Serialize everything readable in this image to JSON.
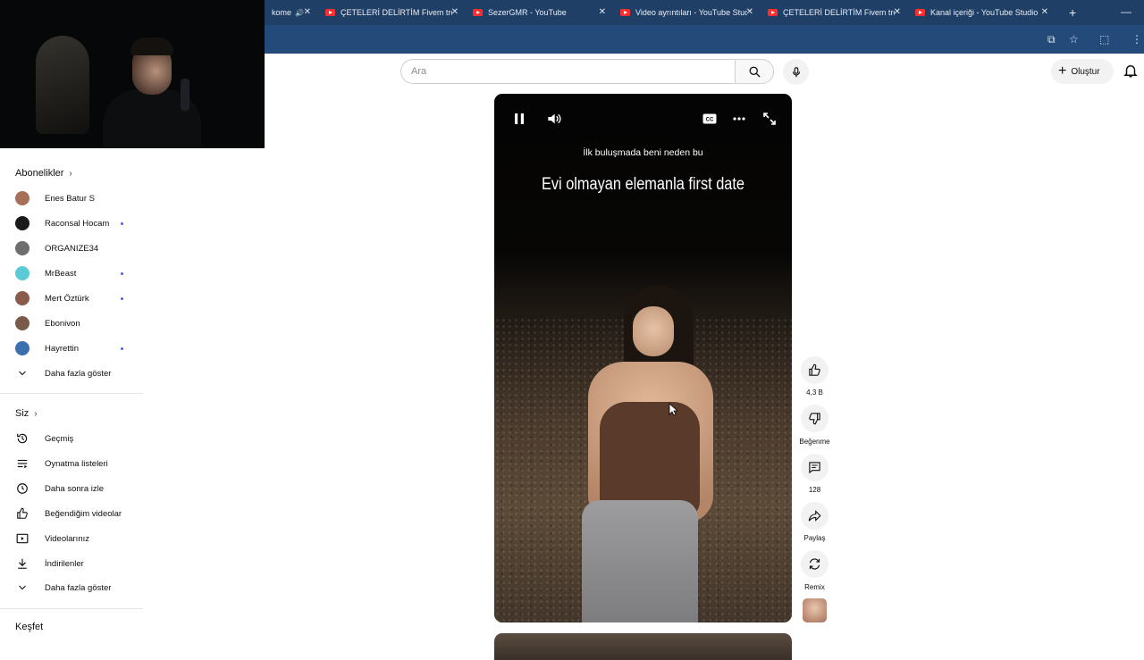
{
  "browser": {
    "tabs": [
      {
        "title": "kome",
        "audio": true
      },
      {
        "title": "ÇETELERİ DELİRTİM Fivem troll..."
      },
      {
        "title": "SezerGMR - YouTube"
      },
      {
        "title": "Video ayrıntıları - YouTube Stud..."
      },
      {
        "title": "ÇETELERİ DELİRTİM Fivem troll..."
      },
      {
        "title": "Kanal içeriği - YouTube Studio"
      }
    ],
    "newtab": "+",
    "minimize": "—"
  },
  "search": {
    "placeholder": "Ara"
  },
  "header": {
    "create_label": "Oluştur"
  },
  "sidebar": {
    "subscriptions_title": "Abonelikler",
    "subscriptions": [
      {
        "label": "Enes Batur S",
        "avatar_color": "#a86f58",
        "new": false
      },
      {
        "label": "Raconsal Hocam",
        "avatar_color": "#1a1a1a",
        "new": true
      },
      {
        "label": "ORGANIZE34",
        "avatar_color": "#6e6e6e",
        "new": false
      },
      {
        "label": "MrBeast",
        "avatar_color": "#5cc9d6",
        "new": true
      },
      {
        "label": "Mert Öztürk",
        "avatar_color": "#8a5a4a",
        "new": true
      },
      {
        "label": "Ebonivon",
        "avatar_color": "#7a5a48",
        "new": false
      },
      {
        "label": "Hayrettin",
        "avatar_color": "#3b6fb0",
        "new": true
      }
    ],
    "show_more_1": "Daha fazla göster",
    "you_title": "Siz",
    "you_items": [
      {
        "label": "Geçmiş",
        "icon": "history-icon"
      },
      {
        "label": "Oynatma listeleri",
        "icon": "playlist-icon"
      },
      {
        "label": "Daha sonra izle",
        "icon": "clock-icon"
      },
      {
        "label": "Beğendiğim videolar",
        "icon": "thumbs-up-icon"
      },
      {
        "label": "Videolarınız",
        "icon": "video-icon"
      },
      {
        "label": "İndirilenler",
        "icon": "download-icon"
      }
    ],
    "show_more_2": "Daha fazla göster",
    "explore_title": "Keşfet"
  },
  "short": {
    "caption_small": "İlk buluşmada beni neden bu",
    "caption_large": "Evi olmayan elemanla first date",
    "state": "playing"
  },
  "actions": {
    "like_count": "4,3 B",
    "dislike_label": "Beğenme",
    "comment_count": "128",
    "share_label": "Paylaş",
    "remix_label": "Remix"
  }
}
